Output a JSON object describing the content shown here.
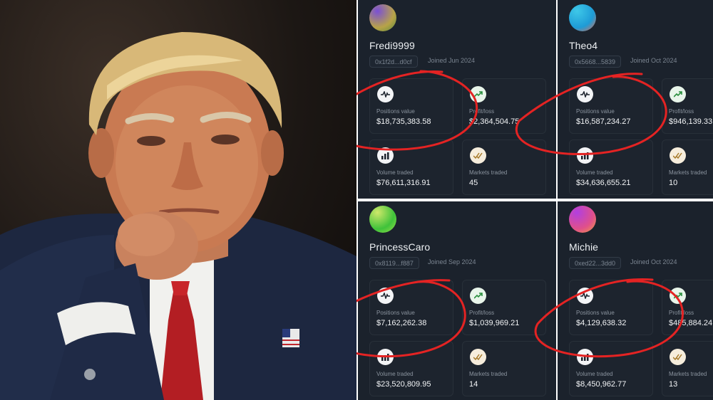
{
  "colors": {
    "panel_bg": "#1b222c",
    "card_bg": "#1d242e",
    "annotation_red": "#e42323"
  },
  "traders": [
    {
      "username": "Fredi9999",
      "address": "0x1f2d...d0cf",
      "joined": "Joined Jun 2024",
      "avatar_colors": [
        "#7a4fd6",
        "#b8a348",
        "#5c8a3a"
      ],
      "positions_label": "Positions value",
      "positions_value": "$18,735,383.58",
      "profit_label": "Profit/loss",
      "profit_value": "$2,364,504.75",
      "volume_label": "Volume traded",
      "volume_value": "$76,611,316.91",
      "markets_label": "Markets traded",
      "markets_value": "45"
    },
    {
      "username": "Theo4",
      "address": "0x5668...5839",
      "joined": "Joined Oct 2024",
      "avatar_colors": [
        "#3ec8e8",
        "#1e9bd6",
        "#e86b4e"
      ],
      "positions_label": "Positions value",
      "positions_value": "$16,587,234.27",
      "profit_label": "Profit/loss",
      "profit_value": "$946,139.33",
      "volume_label": "Volume traded",
      "volume_value": "$34,636,655.21",
      "markets_label": "Markets traded",
      "markets_value": "10"
    },
    {
      "username": "PrincessCaro",
      "address": "0x8119...f887",
      "joined": "Joined Sep 2024",
      "avatar_colors": [
        "#9ae04a",
        "#3fc23a",
        "#cfe86a"
      ],
      "positions_label": "Positions value",
      "positions_value": "$7,162,262.38",
      "profit_label": "Profit/loss",
      "profit_value": "$1,039,969.21",
      "volume_label": "Volume traded",
      "volume_value": "$23,520,809.95",
      "markets_label": "Markets traded",
      "markets_value": "14"
    },
    {
      "username": "Michie",
      "address": "0xed22...3dd0",
      "joined": "Joined Oct 2024",
      "avatar_colors": [
        "#b23fe0",
        "#e0508a",
        "#f0a040"
      ],
      "positions_label": "Positions value",
      "positions_value": "$4,129,638.32",
      "profit_label": "Profit/loss",
      "profit_value": "$485,884.24",
      "volume_label": "Volume traded",
      "volume_value": "$8,450,962.77",
      "markets_label": "Markets traded",
      "markets_value": "13"
    }
  ]
}
